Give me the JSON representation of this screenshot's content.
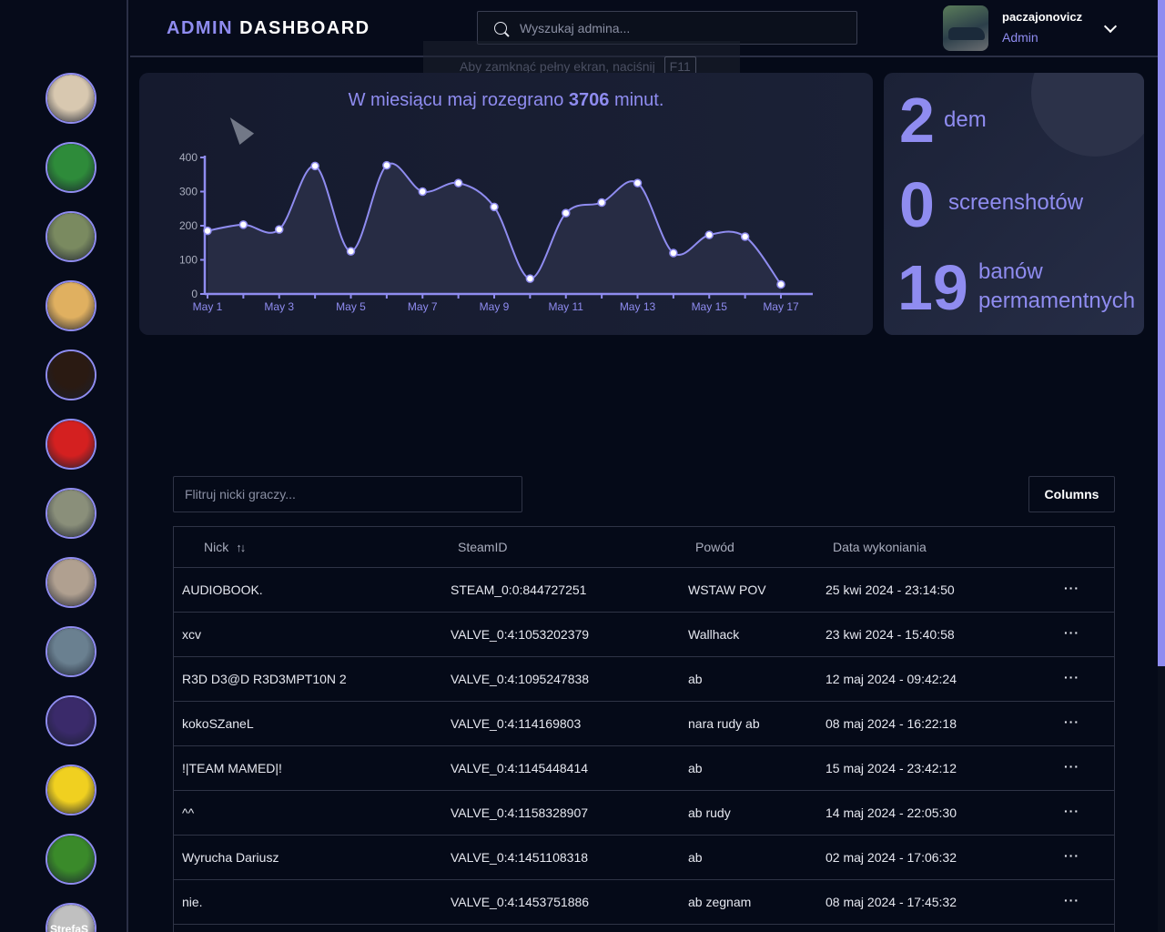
{
  "header": {
    "brand_admin": "ADMIN",
    "brand_dashboard": "DASHBOARD",
    "search_placeholder": "Wyszukaj admina...",
    "username": "paczajonovicz",
    "role": "Admin"
  },
  "fullscreen_hint": {
    "text": "Aby zamknąć pełny ekran, naciśnij",
    "key": "F11"
  },
  "sidebar": {
    "avatars": [
      {
        "name": "avatar-1",
        "color": "#d8c8b0"
      },
      {
        "name": "avatar-2",
        "color": "#2e8b3a"
      },
      {
        "name": "avatar-3",
        "color": "#7a8a60"
      },
      {
        "name": "avatar-4",
        "color": "#e0b060"
      },
      {
        "name": "avatar-5",
        "color": "#2a1a12"
      },
      {
        "name": "avatar-6",
        "color": "#d42020"
      },
      {
        "name": "avatar-7",
        "color": "#8a8f7a"
      },
      {
        "name": "avatar-8",
        "color": "#b0a090"
      },
      {
        "name": "avatar-9",
        "color": "#6a8090"
      },
      {
        "name": "avatar-10",
        "color": "#3a2a6a"
      },
      {
        "name": "avatar-11",
        "color": "#f0d020"
      },
      {
        "name": "avatar-12",
        "color": "#3a8a2a"
      },
      {
        "name": "avatar-13",
        "color": "#c0c0c0",
        "text": "StrefaS"
      }
    ]
  },
  "chart_summary": {
    "prefix": "W miesiącu maj rozegrano",
    "minutes": "3706",
    "suffix": "minut."
  },
  "chart_data": {
    "type": "area",
    "x": [
      "May 1",
      "May 2",
      "May 3",
      "May 4",
      "May 5",
      "May 6",
      "May 7",
      "May 8",
      "May 9",
      "May 10",
      "May 11",
      "May 12",
      "May 13",
      "May 14",
      "May 15",
      "May 16",
      "May 17"
    ],
    "tick_labels": [
      "May 1",
      "May 3",
      "May 5",
      "May 7",
      "May 9",
      "May 11",
      "May 13",
      "May 15",
      "May 17"
    ],
    "series": [
      {
        "values": [
          185,
          203,
          189,
          375,
          125,
          377,
          300,
          325,
          255,
          45,
          237,
          268,
          325,
          120,
          173,
          168,
          28
        ],
        "color": "#8f8cf0"
      }
    ],
    "yticks": [
      0,
      100,
      200,
      300,
      400
    ],
    "ylim": [
      0,
      400
    ],
    "grid": false
  },
  "stats": {
    "dem_count": "2",
    "dem_label": "dem",
    "screens_count": "0",
    "screens_label": "screenshotów",
    "bans_count": "19",
    "bans_label_1": "banów",
    "bans_label_2": "permamentnych"
  },
  "table": {
    "filter_placeholder": "Flitruj nicki graczy...",
    "columns_label": "Columns",
    "headers": {
      "nick": "Nick",
      "steamid": "SteamID",
      "reason": "Powód",
      "date": "Data wykoniania"
    },
    "rows": [
      {
        "nick": "AUDIOBOOK.",
        "steamid": "STEAM_0:0:844727251",
        "reason": "WSTAW POV",
        "date": "25 kwi 2024 - 23:14:50"
      },
      {
        "nick": "xcv",
        "steamid": "VALVE_0:4:1053202379",
        "reason": "Wallhack",
        "date": "23 kwi 2024 - 15:40:58"
      },
      {
        "nick": "R3D D3@D R3D3MPT10N 2",
        "steamid": "VALVE_0:4:1095247838",
        "reason": "ab",
        "date": "12 maj 2024 - 09:42:24"
      },
      {
        "nick": "kokoSZaneL",
        "steamid": "VALVE_0:4:114169803",
        "reason": "nara rudy ab",
        "date": "08 maj 2024 - 16:22:18"
      },
      {
        "nick": "!|TEAM MAMED|!",
        "steamid": "VALVE_0:4:1145448414",
        "reason": "ab",
        "date": "15 maj 2024 - 23:42:12"
      },
      {
        "nick": "^^",
        "steamid": "VALVE_0:4:1158328907",
        "reason": "ab rudy",
        "date": "14 maj 2024 - 22:05:30"
      },
      {
        "nick": "Wyrucha Dariusz",
        "steamid": "VALVE_0:4:1451108318",
        "reason": "ab",
        "date": "02 maj 2024 - 17:06:32"
      },
      {
        "nick": "nie.",
        "steamid": "VALVE_0:4:1453751886",
        "reason": "ab zegnam",
        "date": "08 maj 2024 - 17:45:32"
      }
    ],
    "row_menu": "···"
  }
}
